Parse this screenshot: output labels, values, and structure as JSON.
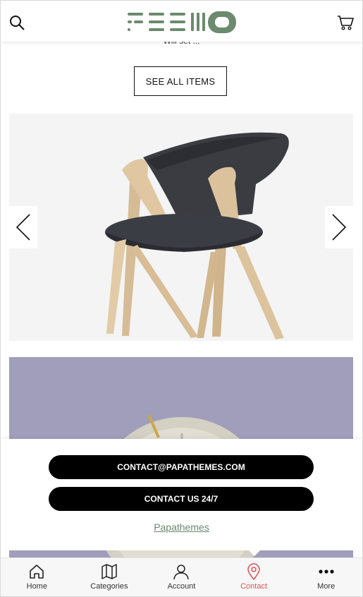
{
  "header": {
    "search_icon": "search-icon",
    "cart_icon": "cart-icon",
    "brand_color": "#6b8a6e"
  },
  "content": {
    "truncated_text": "Will set ...",
    "see_all_label": "SEE ALL ITEMS"
  },
  "carousel": {
    "prev_icon": "chevron-left-icon",
    "next_icon": "chevron-right-icon"
  },
  "contact_panel": {
    "email_button": "CONTACT@PAPATHEMES.COM",
    "contact_button": "CONTACT US 24/7",
    "brand_link": "Papathemes"
  },
  "bottom_nav": {
    "items": [
      {
        "label": "Home",
        "icon": "home-icon"
      },
      {
        "label": "Categories",
        "icon": "map-icon"
      },
      {
        "label": "Account",
        "icon": "user-icon"
      },
      {
        "label": "Contact",
        "icon": "location-pin-icon"
      },
      {
        "label": "More",
        "icon": "more-dots-icon"
      }
    ],
    "active_index": 3,
    "active_color": "#e05050"
  }
}
